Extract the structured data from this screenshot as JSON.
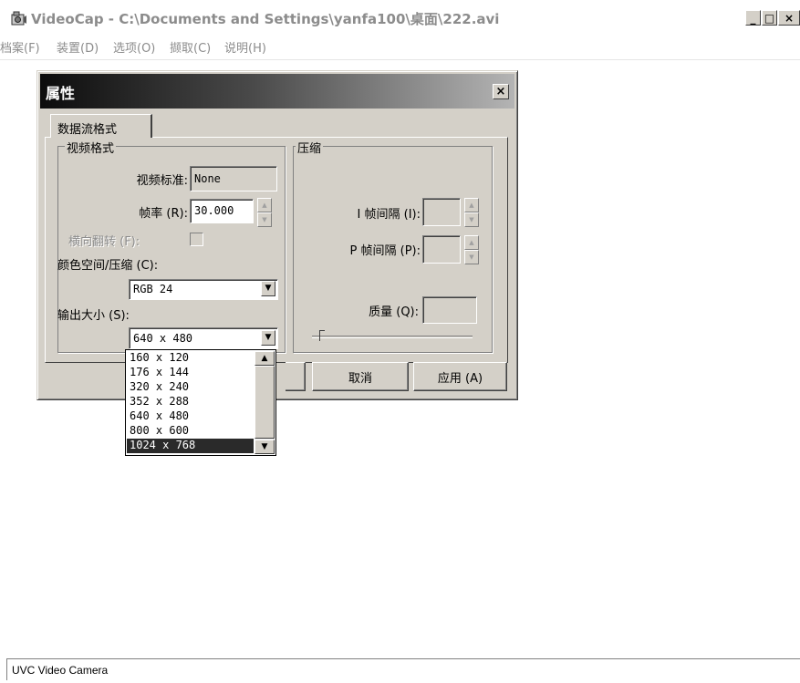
{
  "window": {
    "title": "VideoCap - C:\\Documents and Settings\\yanfa100\\桌面\\222.avi",
    "icon": "camera-icon",
    "minimize_label": "_",
    "maximize_label": "□",
    "close_label": "×"
  },
  "menu": {
    "items": [
      "档案(F)",
      "装置(D)",
      "选项(O)",
      "撷取(C)",
      "说明(H)"
    ]
  },
  "dialog": {
    "title": "属性",
    "close_label": "×",
    "tab": "数据流格式",
    "video_group": {
      "title": "视频格式",
      "standard_label": "视频标准:",
      "standard_value": "None",
      "framerate_label": "帧率 (R):",
      "framerate_value": "30.000",
      "flip_label": "横向翻转 (F):",
      "flip_checked": false,
      "colorspace_label": "颜色空间/压缩 (C):",
      "colorspace_value": "RGB 24",
      "output_size_label": "输出大小 (S):",
      "output_size_value": "640 x 480"
    },
    "compression_group": {
      "title": "压缩",
      "i_frame_label": "I 帧间隔 (I):",
      "i_frame_value": "",
      "p_frame_label": "P 帧间隔 (P):",
      "p_frame_value": "",
      "quality_label": "质量 (Q):",
      "quality_value": ""
    },
    "buttons": {
      "cancel": "取消",
      "apply": "应用 (A)"
    }
  },
  "output_size_options": {
    "items": [
      "160 x 120",
      "176 x 144",
      "320 x 240",
      "352 x 288",
      "640 x 480",
      "800 x 600",
      "1024 x 768"
    ],
    "highlighted": "1024 x 768"
  },
  "status": {
    "text": "UVC Video Camera"
  }
}
